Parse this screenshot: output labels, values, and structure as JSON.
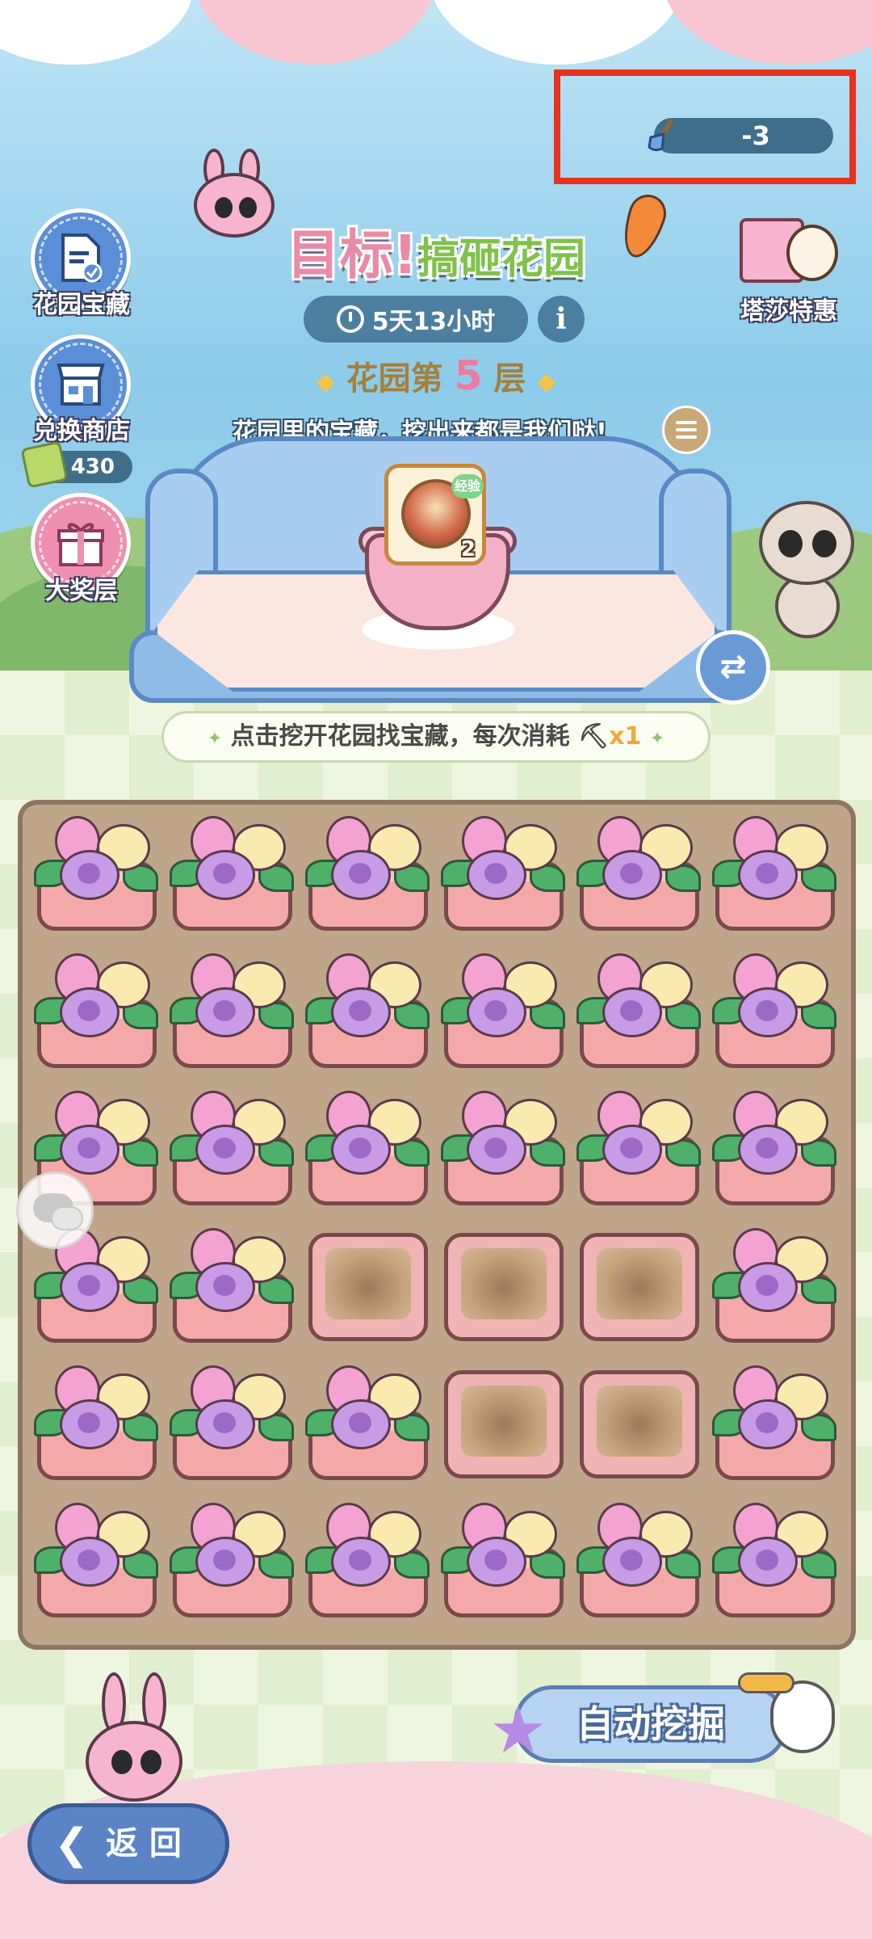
{
  "header": {
    "shovel_count": "-3",
    "title_main": "目标!",
    "title_sub": "搞砸花园",
    "timer": "5天13小时",
    "info_symbol": "i",
    "floor_prefix": "花园第",
    "floor_number": "5",
    "floor_suffix": "层",
    "subtitle": "花园里的宝藏，挖出来都是我们哒!"
  },
  "side_menu": {
    "treasure_label": "花园宝藏",
    "shop_label": "兑换商店",
    "coin_count": "430",
    "grand_prize_label": "大奖层"
  },
  "promo": {
    "label": "塔莎特惠"
  },
  "reward": {
    "badge": "经验",
    "count": "2"
  },
  "instruction": {
    "text": "点击挖开花园找宝藏，每次消耗",
    "cost": "x1"
  },
  "board": {
    "rows": 6,
    "cols": 6,
    "cells": [
      [
        "flower",
        "flower",
        "flower",
        "flower",
        "flower",
        "flower"
      ],
      [
        "flower",
        "flower",
        "flower",
        "flower",
        "flower",
        "flower"
      ],
      [
        "flower",
        "flower",
        "flower",
        "flower",
        "flower",
        "flower"
      ],
      [
        "flower",
        "flower",
        "dug",
        "dug",
        "dug",
        "flower"
      ],
      [
        "flower",
        "flower",
        "flower",
        "dug",
        "dug",
        "flower"
      ],
      [
        "flower",
        "flower",
        "flower",
        "flower",
        "flower",
        "flower"
      ]
    ]
  },
  "buttons": {
    "auto_dig": "自动挖掘",
    "back": "返 回"
  },
  "colors": {
    "highlight_border": "#e8321e",
    "counter_bg": "#3f6e8a",
    "board_bg": "#bfa58a",
    "planter": "#f4a9a8"
  }
}
